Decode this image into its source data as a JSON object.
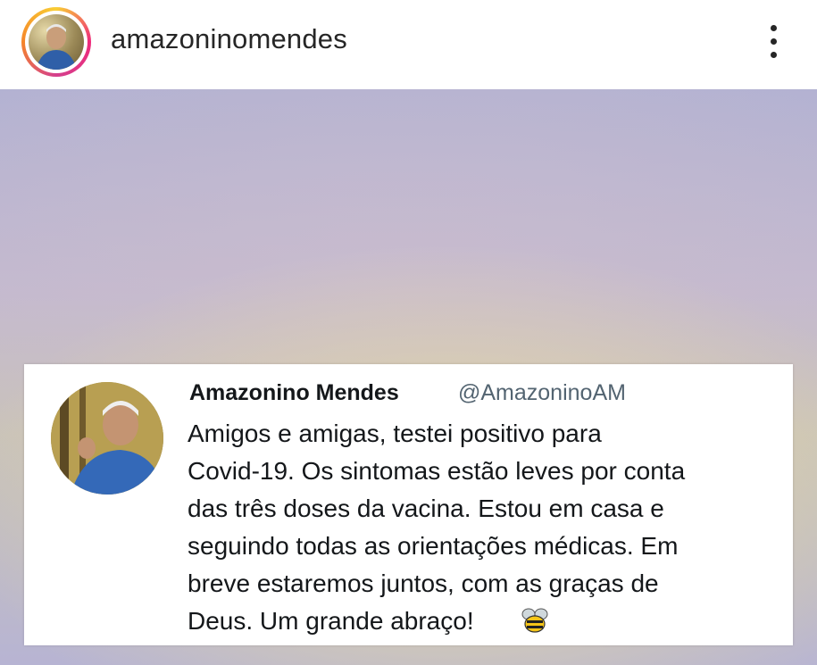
{
  "header": {
    "username": "amazoninomendes"
  },
  "tweet": {
    "name": "Amazonino Mendes",
    "handle": "@AmazoninoAM",
    "lines": [
      "Amigos e amigas, testei positivo para",
      "Covid-19. Os sintomas estão leves por conta",
      "das três doses da vacina. Estou em casa e",
      "seguindo todas as orientações médicas. Em",
      "breve estaremos juntos, com as graças de",
      "Deus. Um grande abraço!"
    ],
    "emoji_icon": "bee-icon"
  },
  "colors": {
    "story_ring": [
      "#f9ce34",
      "#ee2a7b",
      "#f58529"
    ],
    "text_primary": "#14171a",
    "handle_gray": "#536471"
  }
}
